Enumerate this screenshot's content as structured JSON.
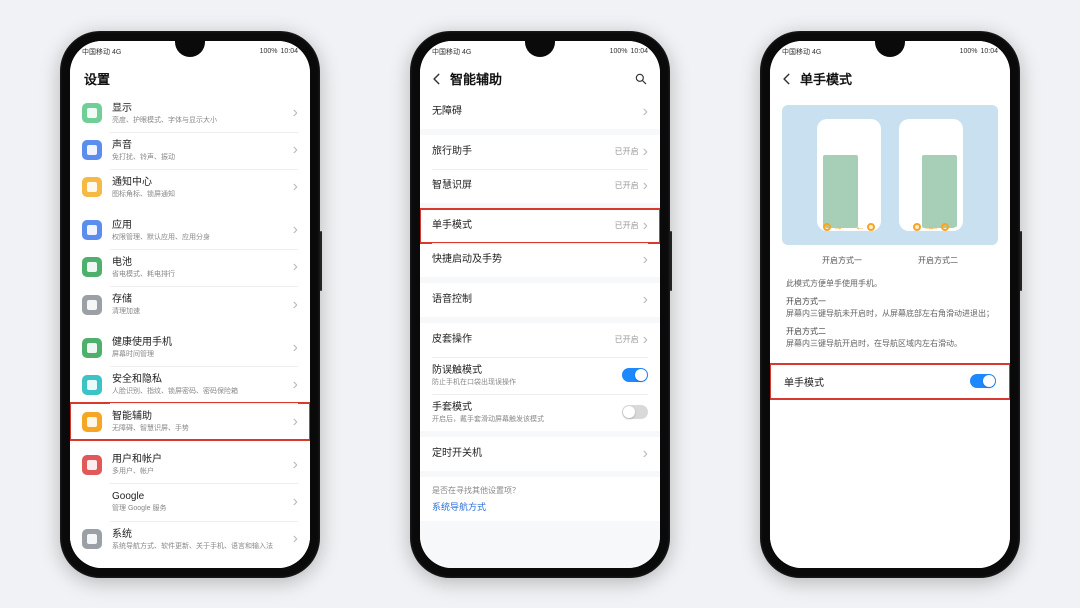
{
  "status": {
    "left": "中国移动 4G",
    "battery": "100%",
    "time": "10:04"
  },
  "screen1": {
    "title": "设置",
    "items": [
      {
        "title": "显示",
        "sub": "亮度、护眼模式、字体与显示大小",
        "color": "#6fcf97"
      },
      {
        "title": "声音",
        "sub": "免打扰、铃声、振动",
        "color": "#5b8def"
      },
      {
        "title": "通知中心",
        "sub": "图标角标、锁屏通知",
        "color": "#f5b945"
      },
      {
        "title": "应用",
        "sub": "权限管理、默认应用、应用分身",
        "color": "#5b8def"
      },
      {
        "title": "电池",
        "sub": "省电模式、耗电排行",
        "color": "#4fb06d"
      },
      {
        "title": "存储",
        "sub": "清理加速",
        "color": "#9aa0a6"
      },
      {
        "title": "健康使用手机",
        "sub": "屏幕时间管理",
        "color": "#4fb06d"
      },
      {
        "title": "安全和隐私",
        "sub": "人脸识别、指纹、锁屏密码、密码保险箱",
        "color": "#3cc3c5"
      },
      {
        "title": "智能辅助",
        "sub": "无障碍、智慧识屏、手势",
        "color": "#f6a623",
        "highlighted": true
      },
      {
        "title": "用户和帐户",
        "sub": "多用户、帐户",
        "color": "#e05858"
      },
      {
        "title": "Google",
        "sub": "管理 Google 服务",
        "color": "#ffffff"
      },
      {
        "title": "系统",
        "sub": "系统导航方式、软件更新、关于手机、语言和输入法",
        "color": "#9aa0a6"
      }
    ]
  },
  "screen2": {
    "title": "智能辅助",
    "rows": [
      {
        "title": "无障碍",
        "right": "",
        "type": "nav"
      },
      {
        "title": "旅行助手",
        "right": "已开启",
        "type": "nav"
      },
      {
        "title": "智慧识屏",
        "right": "已开启",
        "type": "nav"
      },
      {
        "title": "单手模式",
        "right": "已开启",
        "type": "nav",
        "highlighted": true
      },
      {
        "title": "快捷启动及手势",
        "right": "",
        "type": "nav"
      },
      {
        "title": "语音控制",
        "right": "",
        "type": "nav"
      },
      {
        "title": "皮套操作",
        "right": "已开启",
        "type": "nav"
      },
      {
        "title": "防误触模式",
        "sub": "防止手机在口袋出现误操作",
        "type": "toggle",
        "on": true
      },
      {
        "title": "手套模式",
        "sub": "开启后，戴手套滑动屏幕触发该模式",
        "type": "toggle",
        "on": false
      },
      {
        "title": "定时开关机",
        "right": "",
        "type": "nav"
      }
    ],
    "link_q": "是否在寻找其他设置项？",
    "link_a": "系统导航方式"
  },
  "screen3": {
    "title": "单手模式",
    "caption1": "开启方式一",
    "caption2": "开启方式二",
    "desc_main": "此模式方便单手使用手机。",
    "desc1_h": "开启方式一",
    "desc1": "屏幕内三键导航未开启时，从屏幕底部左右角滑动进退出；",
    "desc2_h": "开启方式二",
    "desc2": "屏幕内三键导航开启时，在导航区域内左右滑动。",
    "toggle_label": "单手模式",
    "toggle_on": true
  }
}
